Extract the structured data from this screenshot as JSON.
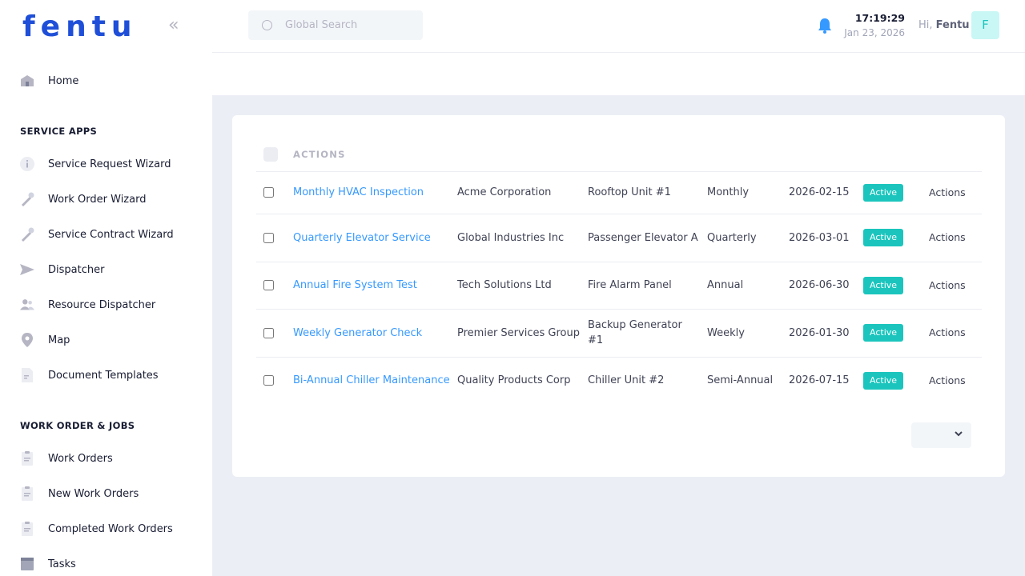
{
  "brand": {
    "logo_text": "fentu",
    "accent": "#1f4fd8"
  },
  "sidebar": {
    "collapse_icon": "double-chevron-left-icon",
    "home": {
      "label": "Home",
      "icon": "home-icon"
    },
    "sections": [
      {
        "title": "SERVICE APPS",
        "items": [
          {
            "label": "Service Request Wizard",
            "icon": "info-icon"
          },
          {
            "label": "Work Order Wizard",
            "icon": "wrench-icon"
          },
          {
            "label": "Service Contract Wizard",
            "icon": "wrench-icon"
          },
          {
            "label": "Dispatcher",
            "icon": "send-icon"
          },
          {
            "label": "Resource Dispatcher",
            "icon": "people-icon"
          },
          {
            "label": "Map",
            "icon": "map-pin-icon"
          },
          {
            "label": "Document Templates",
            "icon": "document-icon"
          }
        ]
      },
      {
        "title": "WORK ORDER & JOBS",
        "items": [
          {
            "label": "Work Orders",
            "icon": "clipboard-icon"
          },
          {
            "label": "New Work Orders",
            "icon": "clipboard-icon"
          },
          {
            "label": "Completed Work Orders",
            "icon": "clipboard-icon"
          },
          {
            "label": "Tasks",
            "icon": "tasks-icon"
          }
        ]
      }
    ]
  },
  "header": {
    "search": {
      "placeholder": "Global Search",
      "value": ""
    },
    "time": "17:19:29",
    "date": "Jan 23, 2026",
    "greeting_prefix": "Hi,",
    "user_name": "Fentu",
    "avatar_letter": "F"
  },
  "table": {
    "header_label": "ACTIONS",
    "rows": [
      {
        "name": "Monthly HVAC Inspection",
        "customer": "Acme Corporation",
        "asset": "Rooftop Unit #1",
        "frequency": "Monthly",
        "date": "2026-02-15",
        "status": "Active",
        "actions": "Actions"
      },
      {
        "name": "Quarterly Elevator Service",
        "customer": "Global Industries Inc",
        "asset": "Passenger Elevator A",
        "frequency": "Quarterly",
        "date": "2026-03-01",
        "status": "Active",
        "actions": "Actions"
      },
      {
        "name": "Annual Fire System Test",
        "customer": "Tech Solutions Ltd",
        "asset": "Fire Alarm Panel",
        "frequency": "Annual",
        "date": "2026-06-30",
        "status": "Active",
        "actions": "Actions"
      },
      {
        "name": "Weekly Generator Check",
        "customer": "Premier Services Group",
        "asset": "Backup Generator #1",
        "frequency": "Weekly",
        "date": "2026-01-30",
        "status": "Active",
        "actions": "Actions"
      },
      {
        "name": "Bi-Annual Chiller Maintenance",
        "customer": "Quality Products Corp",
        "asset": "Chiller Unit #2",
        "frequency": "Semi-Annual",
        "date": "2026-07-15",
        "status": "Active",
        "actions": "Actions"
      }
    ]
  },
  "colors": {
    "link": "#3699ff",
    "status_active": "#1bc5bd",
    "bell": "#3699ff"
  }
}
